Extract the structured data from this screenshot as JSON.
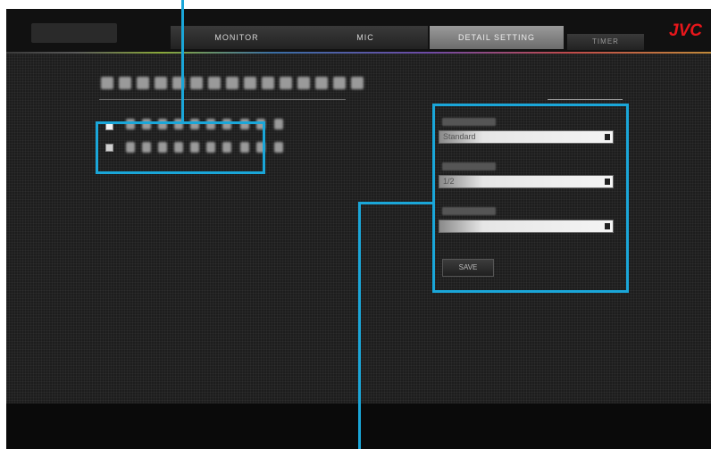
{
  "header": {
    "brand": "JVC",
    "tabs": [
      {
        "label": "MONITOR",
        "active": false
      },
      {
        "label": "MIC",
        "active": false
      },
      {
        "label": "DETAIL SETTING",
        "active": true
      },
      {
        "label": "TIMER",
        "active": false
      }
    ]
  },
  "main": {
    "heading": "",
    "options": [
      {
        "label": "",
        "checked": true
      },
      {
        "label": "",
        "checked": false
      }
    ],
    "settings": {
      "fields": [
        {
          "label": "",
          "value": "Standard"
        },
        {
          "label": "",
          "value": "1/2"
        },
        {
          "label": "",
          "value": ""
        }
      ],
      "save_label": "SAVE"
    }
  },
  "colors": {
    "callout": "#1aa6d8",
    "brand": "#e8161b",
    "background": "#1d1d1d"
  }
}
